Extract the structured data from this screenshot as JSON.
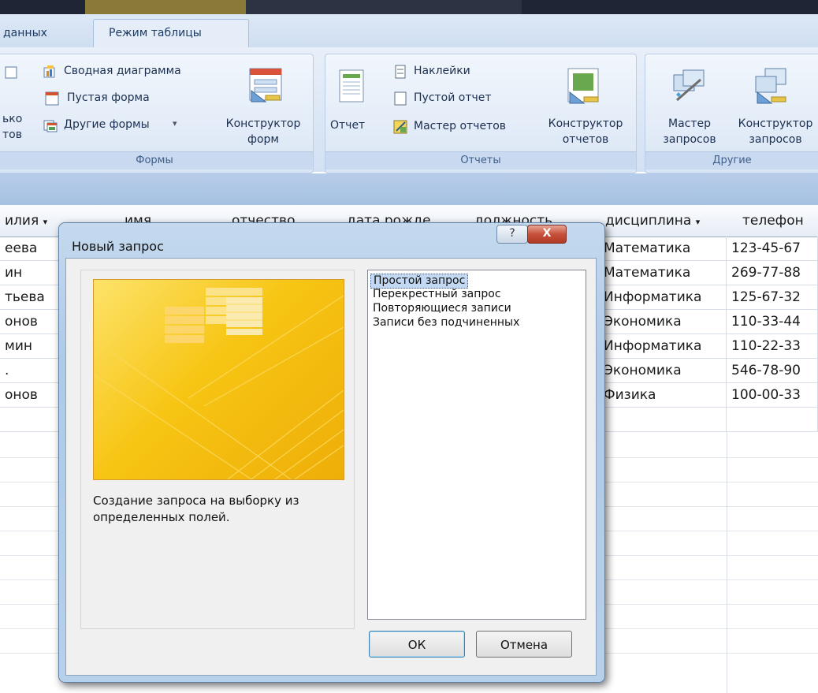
{
  "ribbon_tabs": [
    "данных",
    "Режим таблицы"
  ],
  "groups": {
    "forms": {
      "items": [
        "Сводная диаграмма",
        "Пустая форма",
        "Другие формы"
      ],
      "truncated_label_1": "ько",
      "truncated_label_2": "тов",
      "designer_line1": "Конструктор",
      "designer_line2": "форм",
      "caption": "Формы"
    },
    "reports": {
      "report_label": "Отчет",
      "items": [
        "Наклейки",
        "Пустой отчет",
        "Мастер отчетов"
      ],
      "designer_line1": "Конструктор",
      "designer_line2": "отчетов",
      "caption": "Отчеты"
    },
    "other": {
      "wizard_line1": "Мастер",
      "wizard_line2": "запросов",
      "designer_line1": "Конструктор",
      "designer_line2": "запросов",
      "caption": "Другие"
    }
  },
  "table": {
    "headers": [
      "илия",
      "имя",
      "отчество",
      "дата рожде",
      "должность",
      "дисциплина",
      "телефон"
    ],
    "rows": [
      {
        "surname": "еева",
        "discipline": "Математика",
        "phone": "123-45-67"
      },
      {
        "surname": "ин",
        "discipline": "Математика",
        "phone": "269-77-88"
      },
      {
        "surname": "тьева",
        "discipline": "Информатика",
        "phone": "125-67-32"
      },
      {
        "surname": "онов",
        "discipline": "Экономика",
        "phone": "110-33-44"
      },
      {
        "surname": "мин",
        "discipline": "Информатика",
        "phone": "110-22-33"
      },
      {
        "surname": ".",
        "discipline": "Экономика",
        "phone": "546-78-90"
      },
      {
        "surname": "онов",
        "discipline": "Физика",
        "phone": "100-00-33"
      }
    ]
  },
  "dialog": {
    "title": "Новый запрос",
    "help": "?",
    "close": "X",
    "options": [
      "Простой запрос",
      "Перекрестный запрос",
      "Повторяющиеся записи",
      "Записи без подчиненных"
    ],
    "selected_index": 0,
    "description_line1": "Создание запроса на выборку из",
    "description_line2": "определенных полей.",
    "ok": "ОК",
    "cancel": "Отмена"
  },
  "colors": {
    "accent_selection": "#c3d9f3",
    "preview_yellow": "#f7c514",
    "ribbon_blue": "#d3e1f3"
  }
}
